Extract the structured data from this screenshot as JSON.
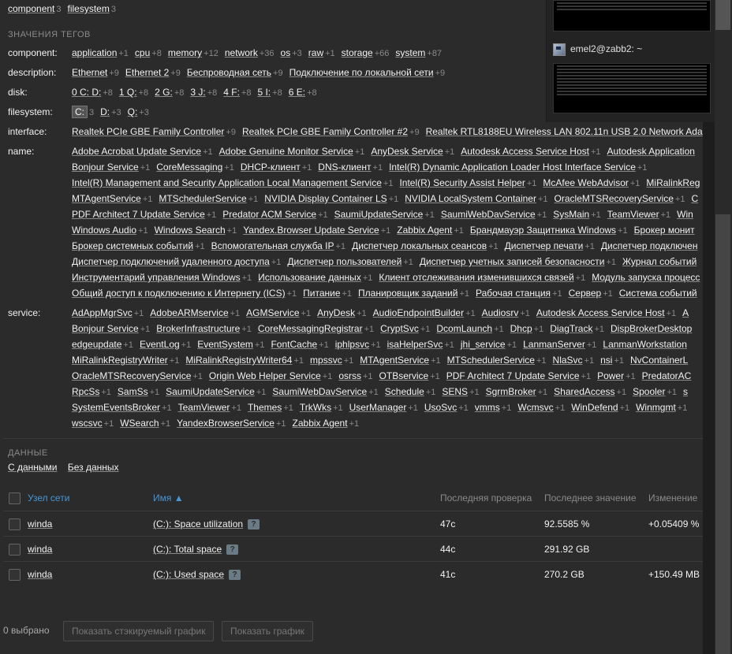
{
  "top_tags": [
    {
      "label": "component",
      "count": "3"
    },
    {
      "label": "filesystem",
      "count": "3"
    }
  ],
  "tag_values_title": "ЗНАЧЕНИЯ ТЕГОВ",
  "tag_rows": [
    {
      "label": "component:",
      "lines": [
        [
          {
            "v": "application",
            "c": "+1"
          },
          {
            "v": "cpu",
            "c": "+8"
          },
          {
            "v": "memory",
            "c": "+12"
          },
          {
            "v": "network",
            "c": "+36"
          },
          {
            "v": "os",
            "c": "+3"
          },
          {
            "v": "raw",
            "c": "+1"
          },
          {
            "v": "storage",
            "c": "+66"
          },
          {
            "v": "system",
            "c": "+87"
          }
        ]
      ]
    },
    {
      "label": "description:",
      "lines": [
        [
          {
            "v": "Ethernet",
            "c": "+9"
          },
          {
            "v": "Ethernet 2",
            "c": "+9"
          },
          {
            "v": "Беспроводная сеть",
            "c": "+9"
          },
          {
            "v": "Подключение по локальной сети",
            "c": "+9"
          }
        ]
      ]
    },
    {
      "label": "disk:",
      "lines": [
        [
          {
            "v": "0 C: D:",
            "c": "+8"
          },
          {
            "v": "1 Q:",
            "c": "+8"
          },
          {
            "v": "2 G:",
            "c": "+8"
          },
          {
            "v": "3 J:",
            "c": "+8"
          },
          {
            "v": "4 F:",
            "c": "+8"
          },
          {
            "v": "5 I:",
            "c": "+8"
          },
          {
            "v": "6 E:",
            "c": "+8"
          }
        ]
      ]
    },
    {
      "label": "filesystem:",
      "lines": [
        [
          {
            "v": "C:",
            "c": "3",
            "sel": true
          },
          {
            "v": "D:",
            "c": "+3"
          },
          {
            "v": "Q:",
            "c": "+3"
          }
        ]
      ]
    },
    {
      "label": "interface:",
      "lines": [
        [
          {
            "v": "Realtek PCIe GBE Family Controller",
            "c": "+9"
          },
          {
            "v": "Realtek PCIe GBE Family Controller #2",
            "c": "+9"
          },
          {
            "v": "Realtek RTL8188EU Wireless LAN 802.11n USB 2.0 Network Ada",
            "c": ""
          }
        ]
      ]
    },
    {
      "label": "name:",
      "lines": [
        [
          {
            "v": "Adobe Acrobat Update Service",
            "c": "+1"
          },
          {
            "v": "Adobe Genuine Monitor Service",
            "c": "+1"
          },
          {
            "v": "AnyDesk Service",
            "c": "+1"
          },
          {
            "v": "Autodesk Access Service Host",
            "c": "+1"
          },
          {
            "v": "Autodesk Application",
            "c": ""
          }
        ],
        [
          {
            "v": "Bonjour Service",
            "c": "+1"
          },
          {
            "v": "CoreMessaging",
            "c": "+1"
          },
          {
            "v": "DHCP-клиент",
            "c": "+1"
          },
          {
            "v": "DNS-клиент",
            "c": "+1"
          },
          {
            "v": "Intel(R) Dynamic Application Loader Host Interface Service",
            "c": "+1"
          }
        ],
        [
          {
            "v": "Intel(R) Management and Security Application Local Management Service",
            "c": "+1"
          },
          {
            "v": "Intel(R) Security Assist Helper",
            "c": "+1"
          },
          {
            "v": "McAfee WebAdvisor",
            "c": "+1"
          },
          {
            "v": "MiRalinkReg",
            "c": ""
          }
        ],
        [
          {
            "v": "MTAgentService",
            "c": "+1"
          },
          {
            "v": "MTSchedulerService",
            "c": "+1"
          },
          {
            "v": "NVIDIA Display Container LS",
            "c": "+1"
          },
          {
            "v": "NVIDIA LocalSystem Container",
            "c": "+1"
          },
          {
            "v": "OracleMTSRecoveryService",
            "c": "+1"
          },
          {
            "v": "C",
            "c": ""
          }
        ],
        [
          {
            "v": "PDF Architect 7 Update Service",
            "c": "+1"
          },
          {
            "v": "Predator ACM Service",
            "c": "+1"
          },
          {
            "v": "SaumiUpdateService",
            "c": "+1"
          },
          {
            "v": "SaumiWebDavService",
            "c": "+1"
          },
          {
            "v": "SysMain",
            "c": "+1"
          },
          {
            "v": "TeamViewer",
            "c": "+1"
          },
          {
            "v": "Win",
            "c": ""
          }
        ],
        [
          {
            "v": "Windows Audio",
            "c": "+1"
          },
          {
            "v": "Windows Search",
            "c": "+1"
          },
          {
            "v": "Yandex.Browser Update Service",
            "c": "+1"
          },
          {
            "v": "Zabbix Agent",
            "c": "+1"
          },
          {
            "v": "Брандмауэр Защитника Windows",
            "c": "+1"
          },
          {
            "v": "Брокер монит",
            "c": ""
          }
        ],
        [
          {
            "v": "Брокер системных событий",
            "c": "+1"
          },
          {
            "v": "Вспомогательная служба IP",
            "c": "+1"
          },
          {
            "v": "Диспетчер локальных сеансов",
            "c": "+1"
          },
          {
            "v": "Диспетчер печати",
            "c": "+1"
          },
          {
            "v": "Диспетчер подключен",
            "c": ""
          }
        ],
        [
          {
            "v": "Диспетчер подключений удаленного доступа",
            "c": "+1"
          },
          {
            "v": "Диспетчер пользователей",
            "c": "+1"
          },
          {
            "v": "Диспетчер учетных записей безопасности",
            "c": "+1"
          },
          {
            "v": "Журнал событий",
            "c": ""
          }
        ],
        [
          {
            "v": "Инструментарий управления Windows",
            "c": "+1"
          },
          {
            "v": "Использование данных",
            "c": "+1"
          },
          {
            "v": "Клиент отслеживания изменившихся связей",
            "c": "+1"
          },
          {
            "v": "Модуль запуска процесс",
            "c": ""
          }
        ],
        [
          {
            "v": "Общий доступ к подключению к Интернету (ICS)",
            "c": "+1"
          },
          {
            "v": "Питание",
            "c": "+1"
          },
          {
            "v": "Планировщик заданий",
            "c": "+1"
          },
          {
            "v": "Рабочая станция",
            "c": "+1"
          },
          {
            "v": "Сервер",
            "c": "+1"
          },
          {
            "v": "Система событий",
            "c": ""
          }
        ]
      ]
    },
    {
      "label": "service:",
      "lines": [
        [
          {
            "v": "AdAppMgrSvc",
            "c": "+1"
          },
          {
            "v": "AdobeARMservice",
            "c": "+1"
          },
          {
            "v": "AGMService",
            "c": "+1"
          },
          {
            "v": "AnyDesk",
            "c": "+1"
          },
          {
            "v": "AudioEndpointBuilder",
            "c": "+1"
          },
          {
            "v": "Audiosrv",
            "c": "+1"
          },
          {
            "v": "Autodesk Access Service Host",
            "c": "+1"
          },
          {
            "v": "A",
            "c": ""
          }
        ],
        [
          {
            "v": "Bonjour Service",
            "c": "+1"
          },
          {
            "v": "BrokerInfrastructure",
            "c": "+1"
          },
          {
            "v": "CoreMessagingRegistrar",
            "c": "+1"
          },
          {
            "v": "CryptSvc",
            "c": "+1"
          },
          {
            "v": "DcomLaunch",
            "c": "+1"
          },
          {
            "v": "Dhcp",
            "c": "+1"
          },
          {
            "v": "DiagTrack",
            "c": "+1"
          },
          {
            "v": "DispBrokerDesktop",
            "c": ""
          }
        ],
        [
          {
            "v": "edgeupdate",
            "c": "+1"
          },
          {
            "v": "EventLog",
            "c": "+1"
          },
          {
            "v": "EventSystem",
            "c": "+1"
          },
          {
            "v": "FontCache",
            "c": "+1"
          },
          {
            "v": "iphlpsvc",
            "c": "+1"
          },
          {
            "v": "isaHelperSvc",
            "c": "+1"
          },
          {
            "v": "jhi_service",
            "c": "+1"
          },
          {
            "v": "LanmanServer",
            "c": "+1"
          },
          {
            "v": "LanmanWorkstation",
            "c": ""
          }
        ],
        [
          {
            "v": "MiRalinkRegistryWriter",
            "c": "+1"
          },
          {
            "v": "MiRalinkRegistryWriter64",
            "c": "+1"
          },
          {
            "v": "mpssvc",
            "c": "+1"
          },
          {
            "v": "MTAgentService",
            "c": "+1"
          },
          {
            "v": "MTSchedulerService",
            "c": "+1"
          },
          {
            "v": "NlaSvc",
            "c": "+1"
          },
          {
            "v": "nsi",
            "c": "+1"
          },
          {
            "v": "NvContainerL",
            "c": ""
          }
        ],
        [
          {
            "v": "OracleMTSRecoveryService",
            "c": "+1"
          },
          {
            "v": "Origin Web Helper Service",
            "c": "+1"
          },
          {
            "v": "osrss",
            "c": "+1"
          },
          {
            "v": "OTBservice",
            "c": "+1"
          },
          {
            "v": "PDF Architect 7 Update Service",
            "c": "+1"
          },
          {
            "v": "Power",
            "c": "+1"
          },
          {
            "v": "PredatorAC",
            "c": ""
          }
        ],
        [
          {
            "v": "RpcSs",
            "c": "+1"
          },
          {
            "v": "SamSs",
            "c": "+1"
          },
          {
            "v": "SaumiUpdateService",
            "c": "+1"
          },
          {
            "v": "SaumiWebDavService",
            "c": "+1"
          },
          {
            "v": "Schedule",
            "c": "+1"
          },
          {
            "v": "SENS",
            "c": "+1"
          },
          {
            "v": "SgrmBroker",
            "c": "+1"
          },
          {
            "v": "SharedAccess",
            "c": "+1"
          },
          {
            "v": "Spooler",
            "c": "+1"
          },
          {
            "v": "s",
            "c": ""
          }
        ],
        [
          {
            "v": "SystemEventsBroker",
            "c": "+1"
          },
          {
            "v": "TeamViewer",
            "c": "+1"
          },
          {
            "v": "Themes",
            "c": "+1"
          },
          {
            "v": "TrkWks",
            "c": "+1"
          },
          {
            "v": "UserManager",
            "c": "+1"
          },
          {
            "v": "UsoSvc",
            "c": "+1"
          },
          {
            "v": "vmms",
            "c": "+1"
          },
          {
            "v": "Wcmsvc",
            "c": "+1"
          },
          {
            "v": "WinDefend",
            "c": "+1"
          },
          {
            "v": "Winmgmt",
            "c": "+1"
          }
        ],
        [
          {
            "v": "wscsvc",
            "c": "+1"
          },
          {
            "v": "WSearch",
            "c": "+1"
          },
          {
            "v": "YandexBrowserService",
            "c": "+1"
          },
          {
            "v": "Zabbix Agent",
            "c": "+1"
          }
        ]
      ]
    }
  ],
  "data_section": {
    "title": "ДАННЫЕ",
    "links": [
      "С данными",
      "Без данных"
    ]
  },
  "table": {
    "headers": {
      "host": "Узел сети",
      "name": "Имя ▲",
      "last_check": "Последняя проверка",
      "last_value": "Последнее значение",
      "change": "Изменение"
    },
    "rows": [
      {
        "host": "winda",
        "name": "(C:): Space utilization",
        "badge": "?",
        "last_check": "47с",
        "last_value": "92.5585 %",
        "change": "+0.05409 %"
      },
      {
        "host": "winda",
        "name": "(C:): Total space",
        "badge": "?",
        "last_check": "44с",
        "last_value": "291.92 GB",
        "change": ""
      },
      {
        "host": "winda",
        "name": "(C:): Used space",
        "badge": "?",
        "last_check": "41с",
        "last_value": "270.2 GB",
        "change": "+150.49 MB"
      }
    ]
  },
  "footer": {
    "selected": "0 выбрано",
    "btn_stacked": "Показать стэкируемый график",
    "btn_graph": "Показать график"
  },
  "overlay": {
    "title": "emel2@zabb2: ~"
  }
}
